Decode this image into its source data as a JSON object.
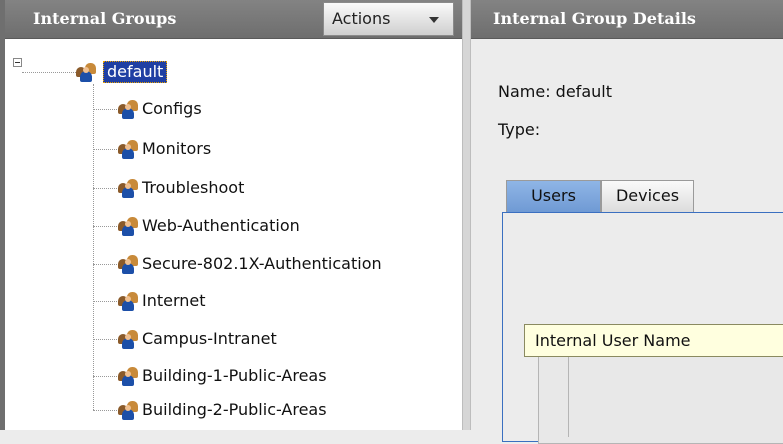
{
  "left_pane": {
    "title": "Internal Groups",
    "actions_label": "Actions",
    "root": "default",
    "children": [
      "Configs",
      "Monitors",
      "Troubleshoot",
      "Web-Authentication",
      "Secure-802.1X-Authentication",
      "Internet",
      "Campus-Intranet",
      "Building-1-Public-Areas",
      "Building-2-Public-Areas"
    ]
  },
  "right_pane": {
    "title": "Internal Group Details",
    "name_line": "Name: default",
    "type_line": "Type:",
    "tabs": [
      "Users",
      "Devices"
    ],
    "selected_tab": "Users",
    "table_headers": [
      "Internal User Name"
    ]
  },
  "icons": {
    "group": "user-group-icon",
    "expander": "tree-collapse-icon",
    "dropdown": "chevron-down-icon"
  },
  "colors": {
    "header_bg": "#767676",
    "selection_bg": "#1f3fa3",
    "selected_tab": "#7aa3da",
    "tooltip_bg": "#ffffdf"
  }
}
